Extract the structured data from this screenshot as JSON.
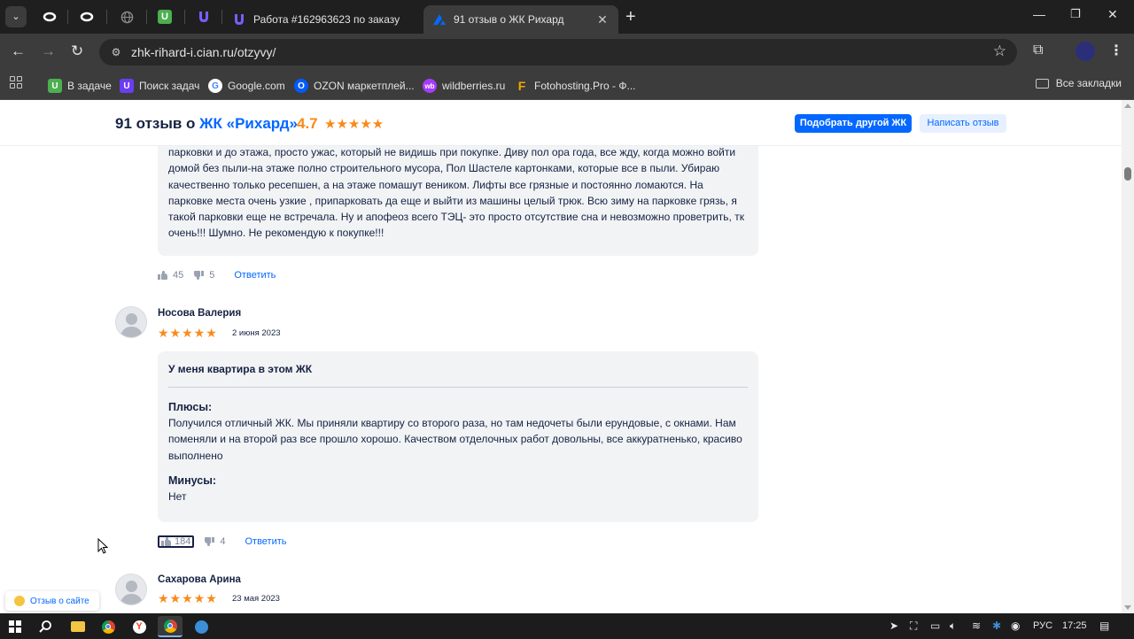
{
  "browser": {
    "tabs": [
      {
        "title": "Работа #162963623 по заказу",
        "favicon": "u-shield-icon"
      },
      {
        "title": "91 отзыв о ЖК Рихард",
        "favicon": "cian-icon"
      }
    ],
    "url": "zhk-rihard-i.cian.ru/otzyvy/",
    "bookmarks": [
      {
        "label": "В задаче",
        "color": "#4caf50",
        "glyph": "U"
      },
      {
        "label": "Поиск задач",
        "color": "#6a3df5",
        "glyph": "U"
      },
      {
        "label": "Google.com",
        "color": "#ffffff",
        "glyph": "G"
      },
      {
        "label": "OZON маркетплей...",
        "color": "#005bff",
        "glyph": "O"
      },
      {
        "label": "wildberries.ru",
        "color": "#a73afd",
        "glyph": "wb"
      },
      {
        "label": "Fotohosting.Pro - Ф...",
        "color": "#f2a900",
        "glyph": "F"
      }
    ],
    "all_bookmarks": "Все закладки"
  },
  "header": {
    "title_prefix": "91 отзыв о ",
    "title_link": "ЖК «Рихард»",
    "rating": "4.7",
    "stars": "★★★★★",
    "btn_primary": "Подобрать другой ЖК",
    "btn_secondary": "Написать отзыв"
  },
  "reviews": [
    {
      "text": "парковки и до этажа, просто ужас, который не видишь при покупке. Диву пол ора года, все жду, когда можно войти домой без пыли-на этаже полно строительного мусора, Пол Шастеле картонками, которые все в пыли. Убираю качественно только ресепшен, а на этаже помашут веником. Лифты все грязные и постоянно ломаются. На парковке места очень узкие , припарковать да еще и выйти из машины целый трюк. Всю зиму на парковке грязь, я такой парковки еще не встречала. Ну и апофеоз всего ТЭЦ- это просто отсутствие сна и невозможно проветрить, тк очень!!! Шумно. Не рекомендую к покупке!!!",
      "likes": "45",
      "dislikes": "5",
      "reply": "Ответить"
    },
    {
      "author": "Носова Валерия",
      "stars": "★★★★★",
      "date": "2 июня 2023",
      "headline": "У меня квартира в этом ЖК",
      "pros_label": "Плюсы:",
      "pros": "Получился отличный ЖК. Мы приняли квартиру со второго раза, но там недочеты были ерундовые, с окнами. Нам поменяли и на второй раз все прошло хорошо. Качеством отделочных работ довольны, все аккуратненько, красиво выполнено",
      "cons_label": "Минусы:",
      "cons": "Нет",
      "likes": "184",
      "dislikes": "4",
      "reply": "Ответить"
    },
    {
      "author": "Сахарова Арина",
      "stars": "★★★★★",
      "date": "23 мая 2023"
    }
  ],
  "feedback_widget": "Отзыв о сайте",
  "taskbar": {
    "lang": "РУС",
    "time": "17:25"
  }
}
